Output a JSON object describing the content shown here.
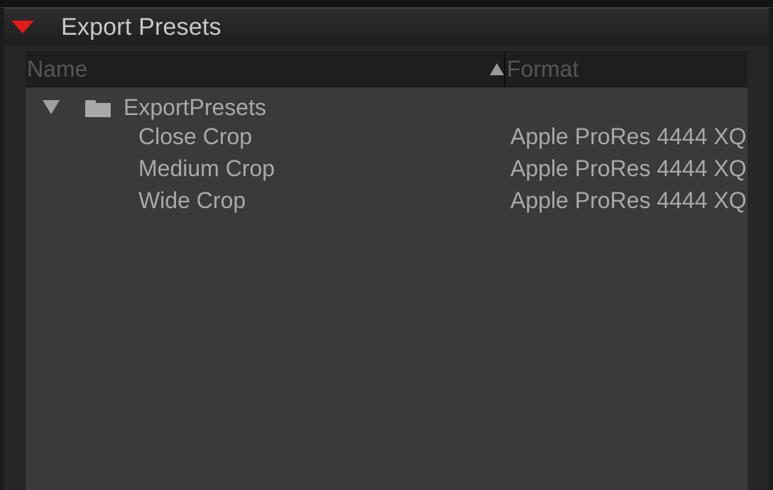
{
  "panel": {
    "title": "Export Presets"
  },
  "table": {
    "columns": {
      "name": "Name",
      "format": "Format"
    },
    "folder": {
      "label": "ExportPresets"
    },
    "rows": [
      {
        "name": "Close Crop",
        "format": "Apple ProRes 4444 XQ"
      },
      {
        "name": "Medium Crop",
        "format": "Apple ProRes 4444 XQ"
      },
      {
        "name": "Wide Crop",
        "format": "Apple ProRes 4444 XQ"
      }
    ]
  },
  "icons": {
    "collapse": "triangle-down-icon",
    "sort": "sort-ascending-icon",
    "expand": "triangle-down-icon",
    "folder": "folder-icon"
  },
  "colors": {
    "accent": "#e11b1b",
    "panel_bg": "#3a3a3a",
    "header_bg": "#1e1e1e",
    "text": "#a8a8a8",
    "header_text": "#555555"
  }
}
